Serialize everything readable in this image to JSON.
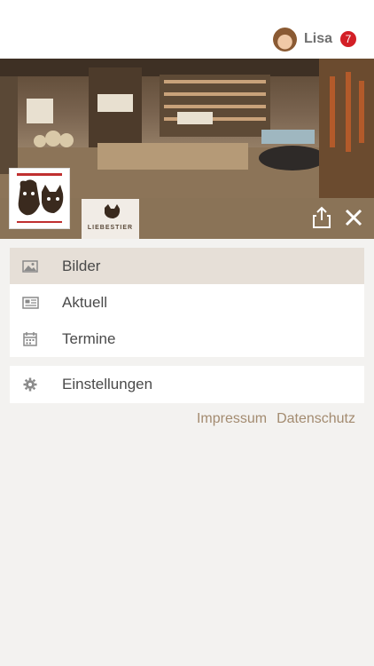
{
  "header": {
    "user_name": "Lisa",
    "notification_count": "7",
    "avatar_icon": "user-avatar"
  },
  "brand": {
    "logo_caption": "LIEBESTIER"
  },
  "menu": {
    "items": [
      {
        "label": "Bilder",
        "icon": "image-icon",
        "active": true
      },
      {
        "label": "Aktuell",
        "icon": "news-icon",
        "active": false
      },
      {
        "label": "Termine",
        "icon": "calendar-icon",
        "active": false
      }
    ]
  },
  "settings": {
    "label": "Einstellungen",
    "icon": "gear-icon"
  },
  "footer": {
    "impressum": "Impressum",
    "datenschutz": "Datenschutz"
  },
  "colors": {
    "accent": "#8a7357",
    "link": "#a38b70",
    "badge": "#d31f26",
    "active_row": "#e6dfd7"
  }
}
